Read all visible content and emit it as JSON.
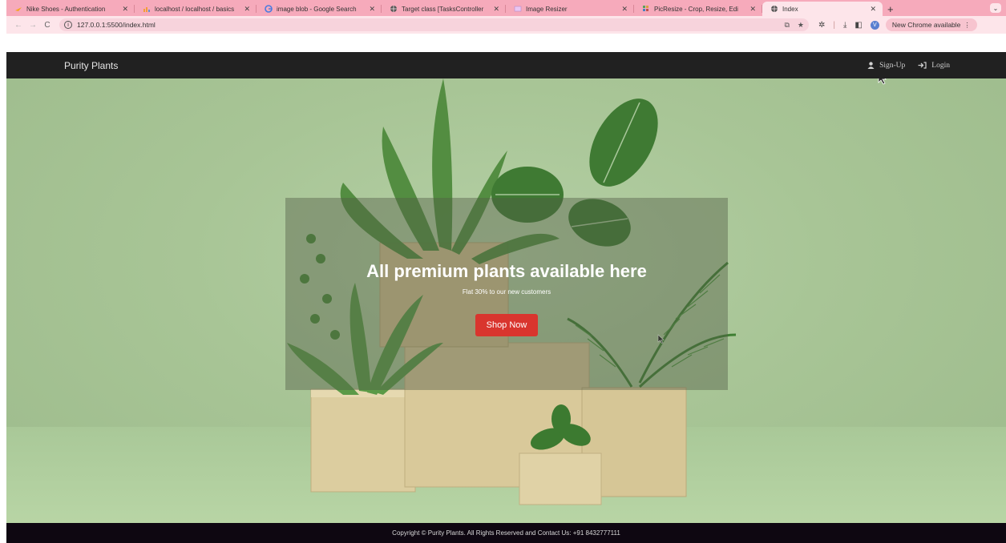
{
  "browser": {
    "tabs": [
      {
        "title": "Nike Shoes - Authentication",
        "icon": "nike-icon"
      },
      {
        "title": "localhost / localhost / basics",
        "icon": "phpmyadmin-icon"
      },
      {
        "title": "image blob - Google Search",
        "icon": "google-icon"
      },
      {
        "title": "Target class [TasksController",
        "icon": "globe-icon"
      },
      {
        "title": "Image Resizer",
        "icon": "image-icon"
      },
      {
        "title": "PicResize - Crop, Resize, Edi",
        "icon": "picresize-icon"
      },
      {
        "title": "Index",
        "icon": "globe-icon",
        "active": true
      }
    ],
    "url": "127.0.0.1:5500/index.html",
    "update_label": "New Chrome available",
    "accent": "#f6aabb"
  },
  "site": {
    "brand": "Purity Plants",
    "nav": {
      "signup": "Sign-Up",
      "login": "Login"
    }
  },
  "hero": {
    "title": "All premium plants available here",
    "subtitle": "Flat 30% to our new customers",
    "cta": "Shop Now",
    "cta_color": "#d9352e"
  },
  "footer": {
    "text": "Copyright © Purity Plants. All Rights Reserved and Contact Us: +91 8432777111"
  }
}
